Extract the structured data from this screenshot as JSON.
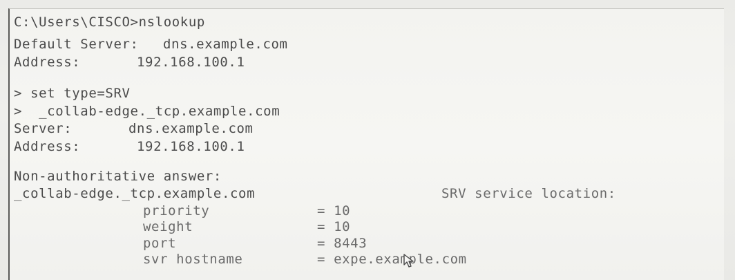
{
  "console": {
    "prompt_line": "C:\\Users\\CISCO>nslookup",
    "default_server_label": "Default Server:",
    "default_server_value": "dns.example.com",
    "address1_label": "Address:",
    "address1_value": "192.168.100.1",
    "cmd_set_type": "> set type=SRV",
    "cmd_query": ">  _collab-edge._tcp.example.com",
    "server_label": "Server:",
    "server_value": "dns.example.com",
    "address2_label": "Address:",
    "address2_value": "192.168.100.1",
    "non_auth": "Non-authoritative answer:",
    "srv_name": "_collab-edge._tcp.example.com",
    "srv_location": "SRV service location:",
    "records": [
      {
        "key": "priority",
        "value": "= 10"
      },
      {
        "key": "weight",
        "value": "= 10"
      },
      {
        "key": "port",
        "value": "= 8443"
      },
      {
        "key": "svr hostname",
        "value": "= expe.example.com"
      }
    ]
  }
}
